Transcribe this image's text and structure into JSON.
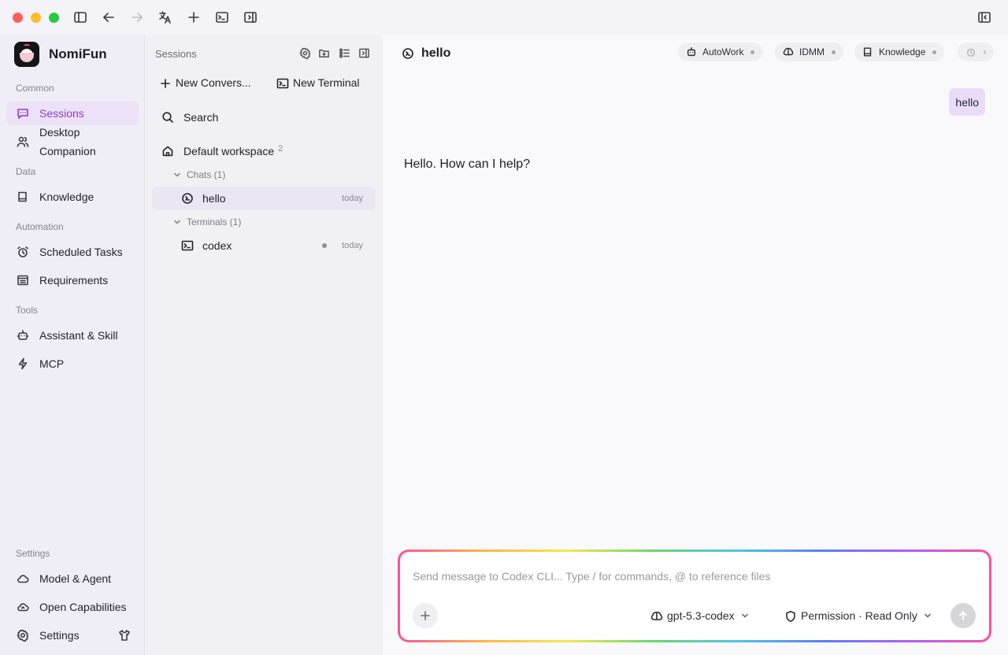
{
  "app": {
    "name": "NomiFun"
  },
  "nav": {
    "sections": {
      "common": "Common",
      "data": "Data",
      "automation": "Automation",
      "tools": "Tools",
      "settings": "Settings"
    },
    "items": {
      "sessions": "Sessions",
      "desktop_companion": "Desktop Companion",
      "knowledge": "Knowledge",
      "scheduled_tasks": "Scheduled Tasks",
      "requirements": "Requirements",
      "assistant_skill": "Assistant & Skill",
      "mcp": "MCP",
      "model_agent": "Model & Agent",
      "open_capabilities": "Open Capabilities",
      "settings": "Settings"
    }
  },
  "sessions_panel": {
    "title": "Sessions",
    "new_conversation": "New Convers...",
    "new_terminal": "New Terminal",
    "search": "Search",
    "workspace": {
      "name": "Default workspace",
      "count": "2"
    },
    "chats_group": "Chats (1)",
    "terminals_group": "Terminals (1)",
    "chat_items": [
      {
        "name": "hello",
        "time": "today"
      }
    ],
    "terminal_items": [
      {
        "name": "codex",
        "time": "today"
      }
    ]
  },
  "main": {
    "title": "hello",
    "pills": {
      "autowork": "AutoWork",
      "idmm": "IDMM",
      "knowledge": "Knowledge"
    },
    "messages": {
      "user": "hello",
      "assistant": "Hello. How can I help?"
    },
    "composer": {
      "placeholder": "Send message to Codex CLI...  Type / for commands, @ to reference files",
      "model": "gpt-5.3-codex",
      "permission": "Permission · Read Only"
    }
  },
  "colors": {
    "accent": "#8b3bd0",
    "active_bg": "#ece1f6",
    "user_bubble": "#eadbfb"
  }
}
